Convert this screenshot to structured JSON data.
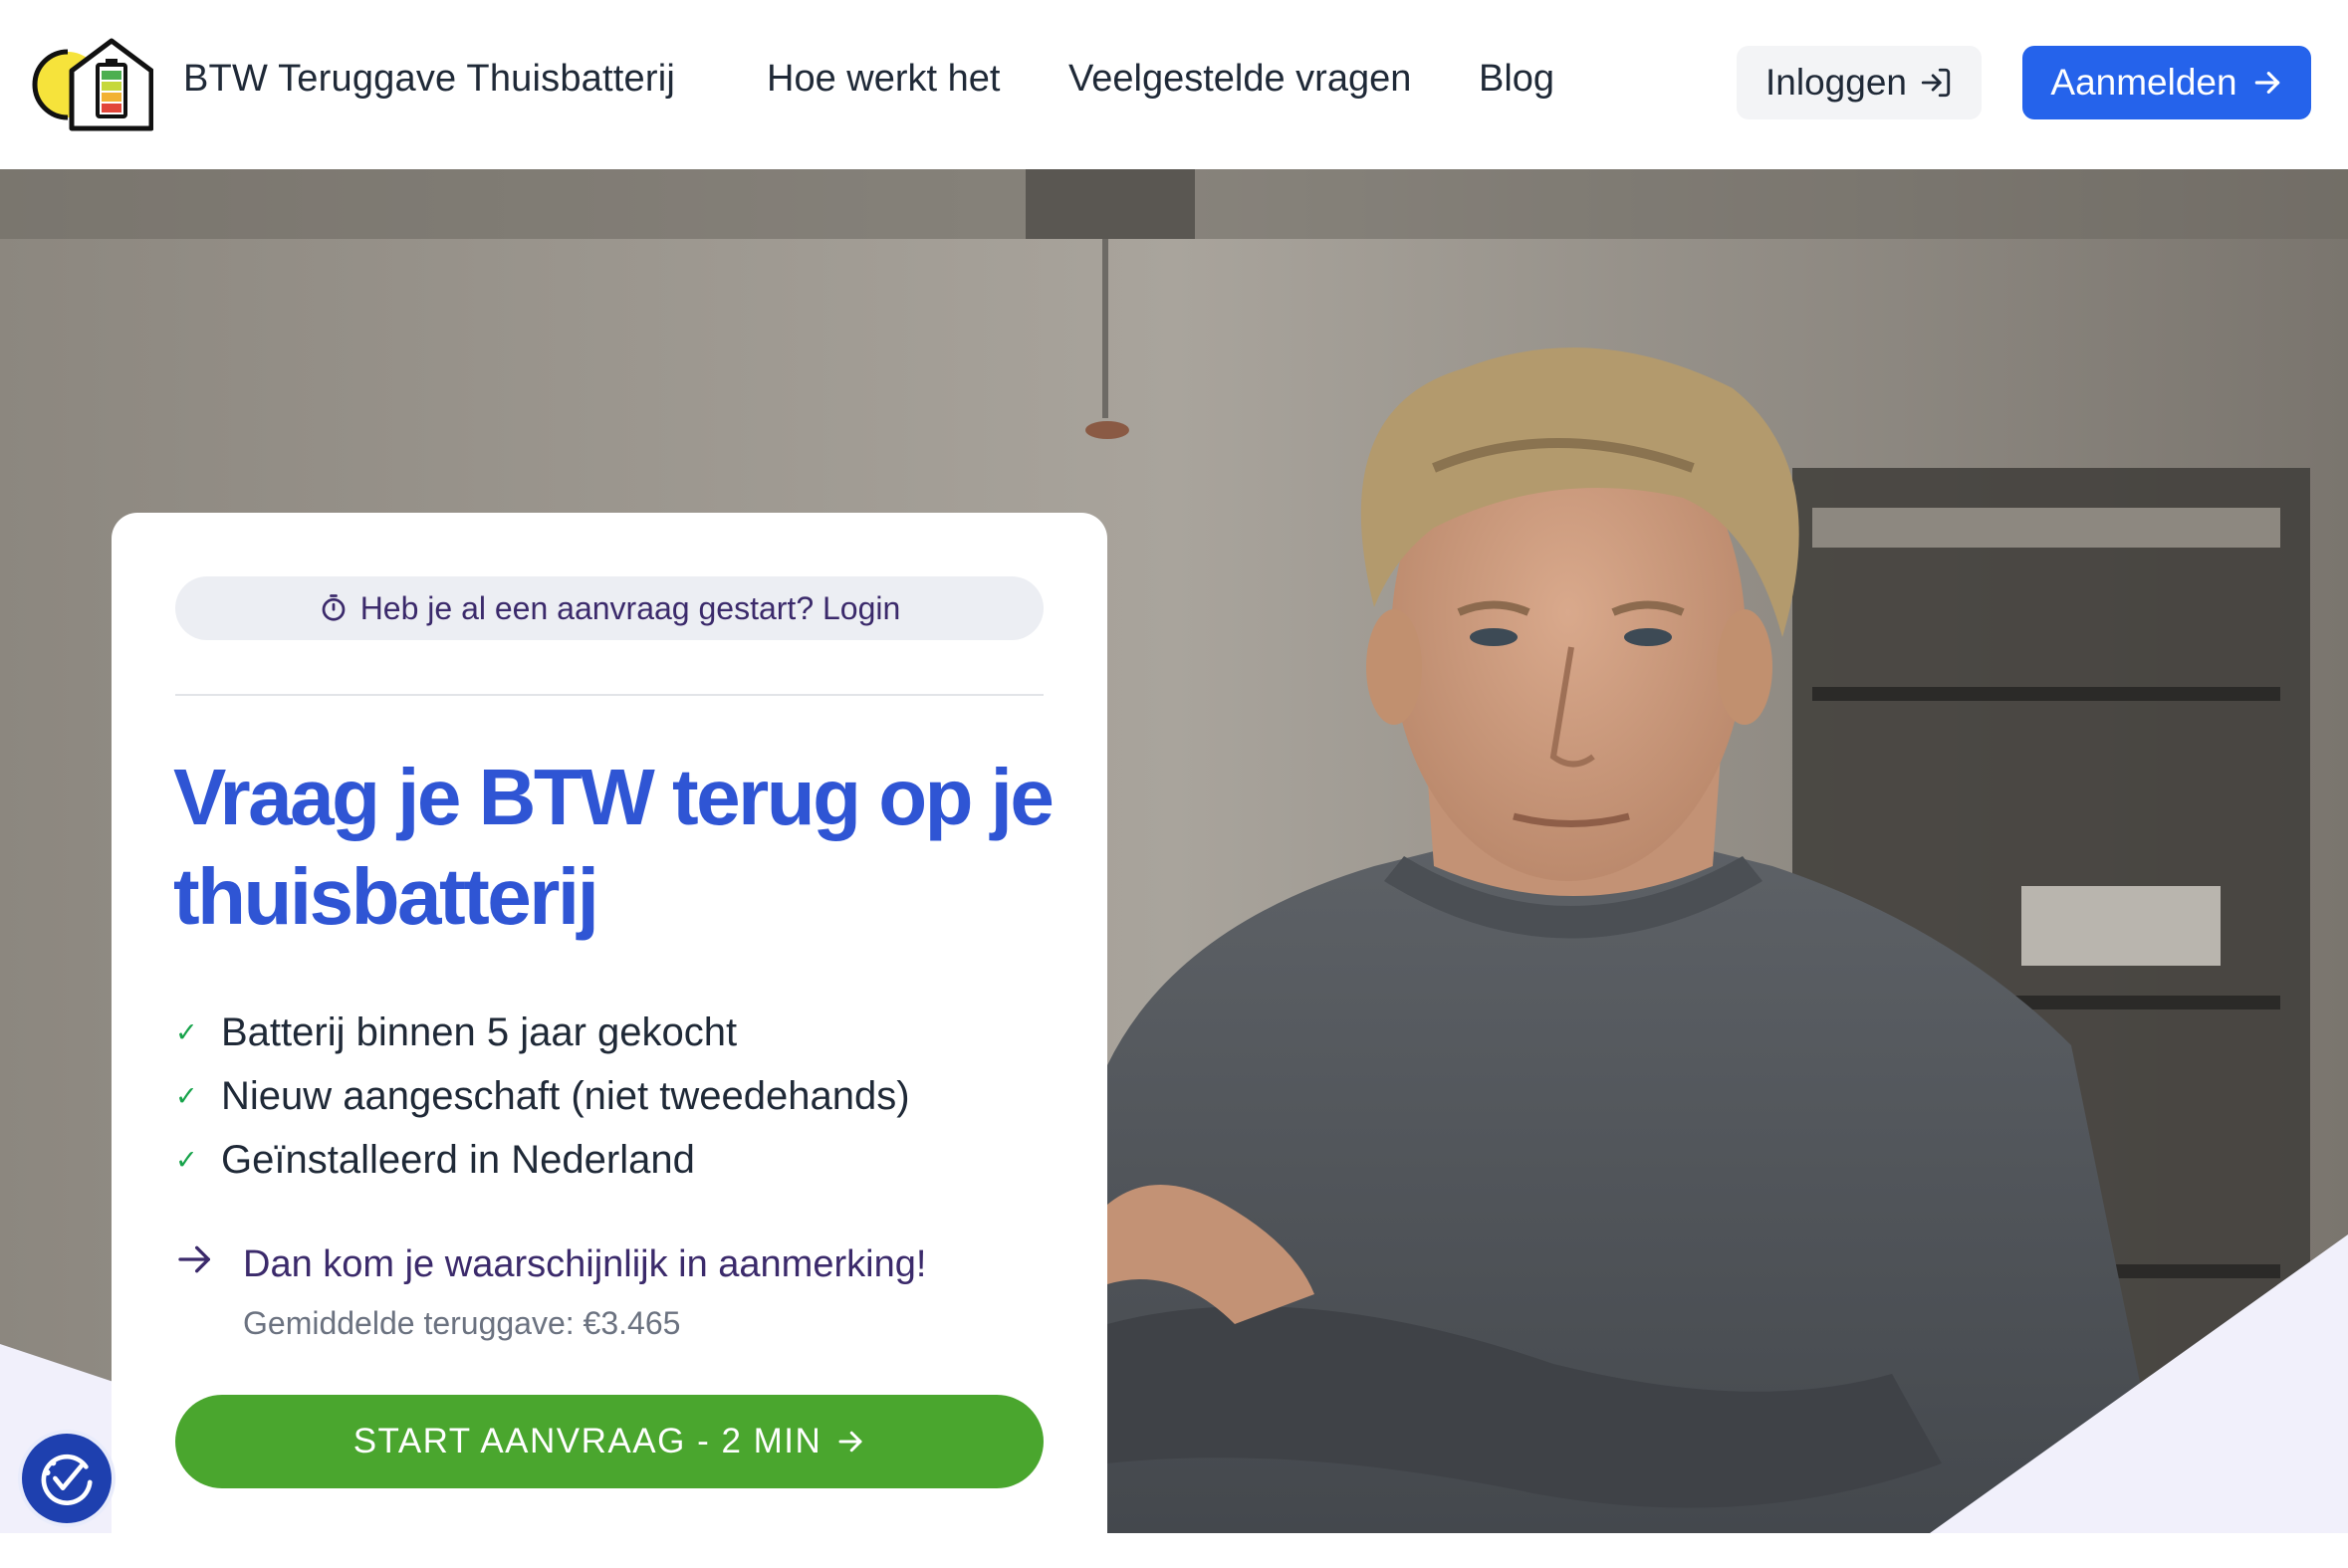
{
  "header": {
    "brand": "BTW Teruggave Thuisbatterij",
    "nav": [
      {
        "label": "Hoe werkt het"
      },
      {
        "label": "Veelgestelde vragen"
      },
      {
        "label": "Blog"
      }
    ],
    "login_label": "Inloggen",
    "signup_label": "Aanmelden"
  },
  "hero": {
    "photo_alt": "Man met gekruiste armen voor een garage"
  },
  "card": {
    "pill_text": "Heb je al een aanvraag gestart? Login",
    "headline": "Vraag je BTW terug op je thuisbatterij",
    "checks": [
      {
        "label": "Batterij binnen 5 jaar gekocht"
      },
      {
        "label": "Nieuw aangeschaft (niet tweedehands)"
      },
      {
        "label": "Geïnstalleerd in Nederland"
      }
    ],
    "eligible_text": "Dan kom je waarschijnlijk in aanmerking!",
    "average_refund": "Gemiddelde teruggave: €3.465",
    "cta_label": "START AANVRAAG - 2 MIN"
  },
  "icons": {
    "logo": "house-battery-icon",
    "login": "login-arrow-icon",
    "signup": "arrow-right-icon",
    "pill": "stopwatch-icon",
    "check": "check-icon",
    "eligible": "arrow-right-icon",
    "accessibility": "accessibility-check-icon"
  },
  "colors": {
    "primary": "#2563eb",
    "headline": "#2f55d4",
    "cta": "#4aa62e",
    "accent_text": "#3b2a6b",
    "check": "#16a34a"
  }
}
